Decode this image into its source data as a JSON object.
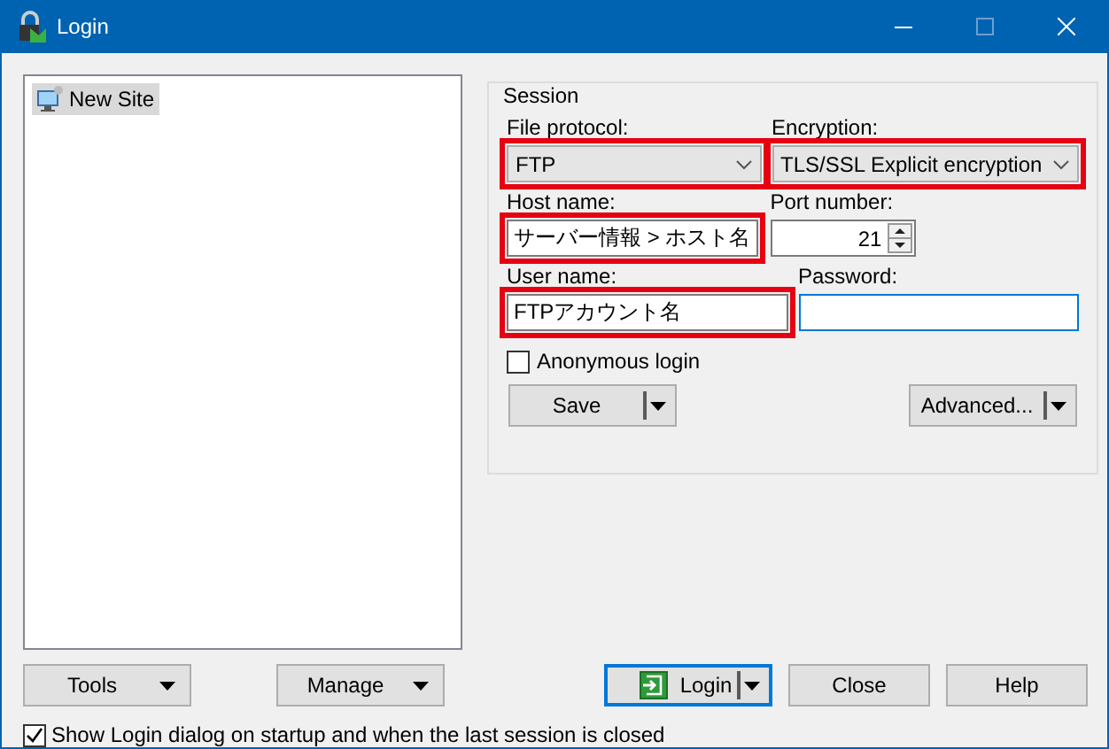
{
  "window": {
    "title": "Login",
    "maximize_enabled": false
  },
  "sites": [
    {
      "label": "New Site",
      "selected": true
    }
  ],
  "session": {
    "title": "Session",
    "rows": [
      {
        "fields": [
          {
            "kind": "combo",
            "label": "File protocol:",
            "value": "FTP",
            "highlighted": true,
            "focused": false
          },
          {
            "kind": "combo",
            "label": "Encryption:",
            "value": "TLS/SSL Explicit encryption",
            "highlighted": true,
            "focused": false
          }
        ]
      },
      {
        "fields": [
          {
            "kind": "text",
            "label": "Host name:",
            "value": "サーバー情報 > ホスト名",
            "highlighted": true,
            "focused": false
          },
          {
            "kind": "spin",
            "label": "Port number:",
            "value": "21",
            "highlighted": false,
            "focused": false
          }
        ]
      },
      {
        "fields": [
          {
            "kind": "text",
            "label": "User name:",
            "value": "FTPアカウント名",
            "highlighted": true,
            "focused": false
          },
          {
            "kind": "password",
            "label": "Password:",
            "highlighted": false,
            "focused": true
          }
        ]
      }
    ],
    "anonymous": {
      "label": "Anonymous login",
      "checked": false
    },
    "buttons": [
      {
        "label": "Save",
        "kind": "split"
      },
      {
        "label": "Advanced...",
        "kind": "split"
      }
    ]
  },
  "left_buttons": [
    {
      "label": "Tools",
      "kind": "menu"
    },
    {
      "label": "Manage",
      "kind": "menu"
    }
  ],
  "right_buttons": [
    {
      "label": "Login",
      "kind": "split",
      "default": true,
      "icon": true
    },
    {
      "label": "Close",
      "kind": "plain",
      "default": false,
      "icon": false
    },
    {
      "label": "Help",
      "kind": "plain",
      "default": false,
      "icon": false
    }
  ],
  "show_on_startup": {
    "label": "Show Login dialog on startup and when the last session is closed",
    "checked": true
  }
}
